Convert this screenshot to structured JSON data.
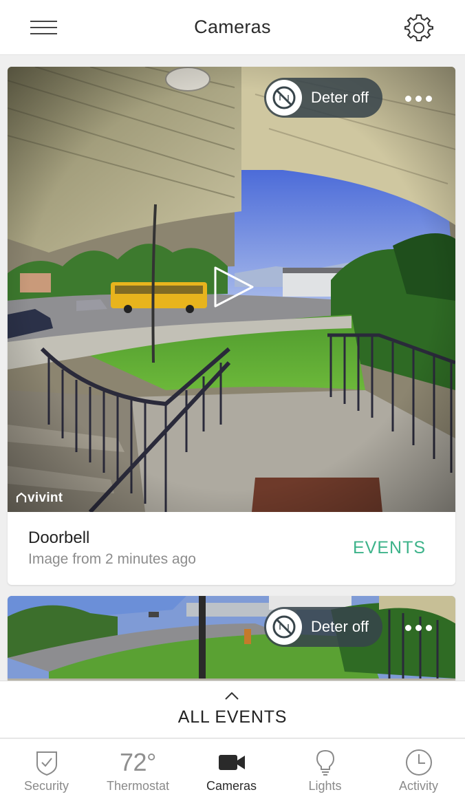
{
  "header": {
    "title": "Cameras",
    "menu_icon": "hamburger-menu-icon",
    "settings_icon": "gear-icon"
  },
  "cameras": [
    {
      "deter_label": "Deter off",
      "deter_icon": "deter-off-icon",
      "more_icon": "more-horizontal-icon",
      "play_icon": "play-icon",
      "brand": "vivint",
      "name": "Doorbell",
      "subtitle": "Image from 2 minutes ago",
      "events_label": "EVENTS"
    },
    {
      "deter_label": "Deter off",
      "deter_icon": "deter-off-icon",
      "more_icon": "more-horizontal-icon"
    }
  ],
  "drawer": {
    "label": "ALL EVENTS",
    "icon": "chevron-up-icon"
  },
  "tabs": [
    {
      "label": "Security",
      "icon": "shield-check-icon"
    },
    {
      "label": "Thermostat",
      "value": "72°"
    },
    {
      "label": "Cameras",
      "icon": "video-camera-icon",
      "active": true
    },
    {
      "label": "Lights",
      "icon": "lightbulb-icon"
    },
    {
      "label": "Activity",
      "icon": "clock-icon"
    }
  ],
  "colors": {
    "accent": "#3db38a",
    "pill": "#37444a",
    "active_tab": "#2a2a2a",
    "inactive_tab": "#8a8a8a"
  }
}
